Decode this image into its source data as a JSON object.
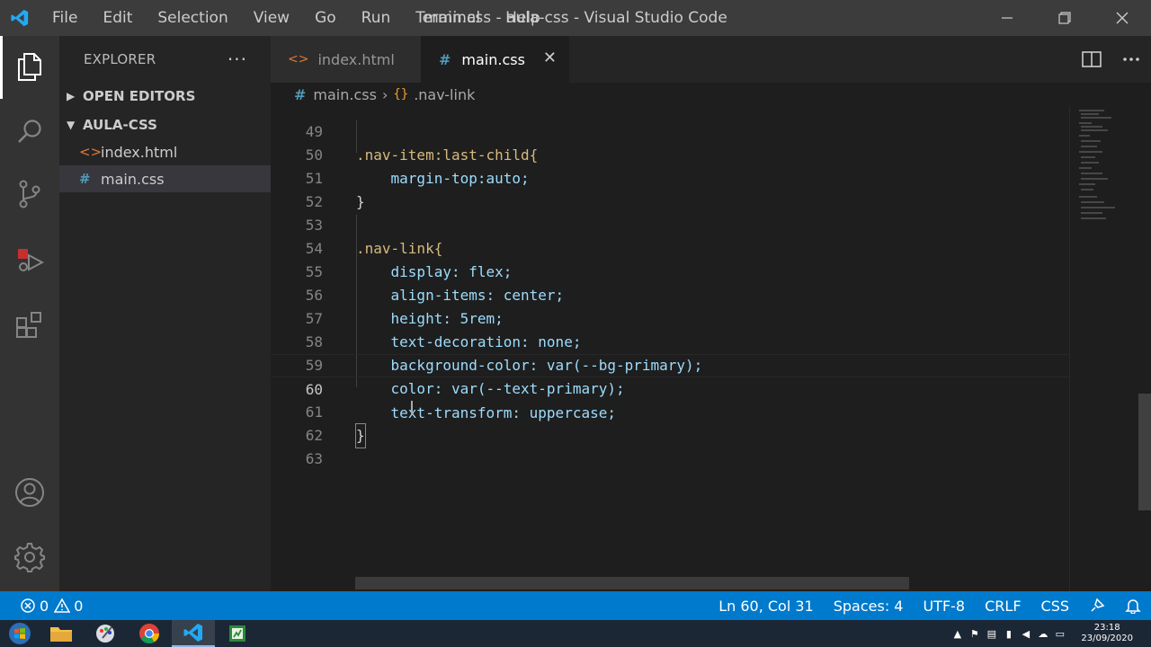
{
  "titlebar": {
    "menu": [
      "File",
      "Edit",
      "Selection",
      "View",
      "Go",
      "Run",
      "Terminal",
      "Help"
    ],
    "title": "main.css - aula-css - Visual Studio Code"
  },
  "activitybar": {
    "icons": [
      "explorer-icon",
      "search-icon",
      "source-control-icon",
      "run-debug-icon",
      "extensions-icon",
      "account-icon",
      "settings-gear-icon"
    ]
  },
  "sidebar": {
    "title": "EXPLORER",
    "more": "···",
    "open_editors": "OPEN EDITORS",
    "folder": "AULA-CSS",
    "files": [
      {
        "icon": "<>",
        "name": "index.html"
      },
      {
        "icon": "#",
        "name": "main.css"
      }
    ]
  },
  "tabs": [
    {
      "icon": "<>",
      "label": "index.html"
    },
    {
      "icon": "#",
      "label": "main.css",
      "close": "✕"
    }
  ],
  "breadcrumb": {
    "file": "main.css",
    "symbol": ".nav-link"
  },
  "editor": {
    "lines": [
      {
        "n": "49",
        "code": ".nav-item:last-child{"
      },
      {
        "n": "50",
        "code": "    margin-top:auto;"
      },
      {
        "n": "51",
        "code": "}"
      },
      {
        "n": "52",
        "code": ""
      },
      {
        "n": "53",
        "code": ".nav-link{"
      },
      {
        "n": "54",
        "code": "    display: flex;"
      },
      {
        "n": "55",
        "code": "    align-items: center;"
      },
      {
        "n": "56",
        "code": "    height: 5rem;"
      },
      {
        "n": "57",
        "code": "    text-decoration: none;"
      },
      {
        "n": "58",
        "code": "    background-color: var(--bg-primary);"
      },
      {
        "n": "59",
        "code": "    color: var(--text-primary);"
      },
      {
        "n": "60",
        "code": "    text-transform: uppercase;"
      },
      {
        "n": "61",
        "code": "}"
      },
      {
        "n": "62",
        "code": ""
      },
      {
        "n": "63",
        "code": ""
      }
    ]
  },
  "statusbar": {
    "errors": "0",
    "warnings": "0",
    "position": "Ln 60, Col 31",
    "spaces": "Spaces: 4",
    "encoding": "UTF-8",
    "eol": "CRLF",
    "language": "CSS"
  },
  "taskbar": {
    "apps": [
      "windows-start-icon",
      "file-explorer-icon",
      "paint-icon",
      "chrome-icon",
      "vscode-icon",
      "spreadsheet-icon"
    ],
    "time": "23:18",
    "date": "23/09/2020"
  },
  "colors": {
    "accent": "#007acc",
    "titlebar": "#3c3c3c",
    "sidebar": "#252526",
    "editor": "#1e1e1e"
  }
}
